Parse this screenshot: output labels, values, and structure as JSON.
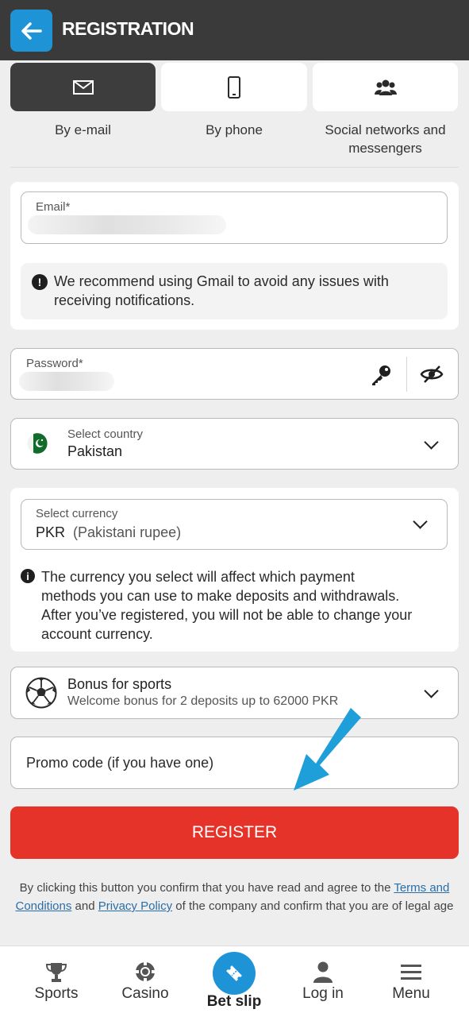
{
  "header": {
    "title": "REGISTRATION",
    "back_icon": "arrow-left-icon"
  },
  "methods": [
    {
      "label": "By e-mail",
      "icon": "envelope-icon",
      "active": true
    },
    {
      "label": "By phone",
      "icon": "phone-icon",
      "active": false
    },
    {
      "label_line1": "Social networks and",
      "label_line2": "messengers",
      "icon": "people-icon",
      "active": false
    }
  ],
  "email": {
    "label": "Email*",
    "value": ""
  },
  "email_notice": {
    "line1": "We recommend using Gmail to avoid any issues with",
    "line2": "receiving notifications."
  },
  "password": {
    "label": "Password*",
    "value": ""
  },
  "country": {
    "label": "Select country",
    "value": "Pakistan"
  },
  "currency": {
    "label": "Select currency",
    "code": "PKR",
    "name": "(Pakistani rupee)"
  },
  "currency_notice": {
    "line1": "The currency you select will affect which payment",
    "line2": "methods you can use to make deposits and withdrawals.",
    "line3": "After you’ve registered, you will not be able to change your",
    "line4": "account currency."
  },
  "bonus": {
    "title": "Bonus for sports",
    "subtitle": "Welcome bonus for 2 deposits up to 62000 PKR"
  },
  "promo": {
    "placeholder": "Promo code (if you have one)"
  },
  "register_label": "REGISTER",
  "legal": {
    "part1": "By clicking this button you confirm that you have read and agree to the ",
    "terms": "Terms and Conditions",
    "part2": " and ",
    "privacy": "Privacy Policy",
    "part3": " of the company and confirm that you are of legal age"
  },
  "nav": [
    {
      "label": "Sports",
      "icon": "trophy-icon"
    },
    {
      "label": "Casino",
      "icon": "casino-chip-icon"
    },
    {
      "label": "Bet slip",
      "icon": "ticket-icon"
    },
    {
      "label": "Log in",
      "icon": "user-icon"
    },
    {
      "label": "Menu",
      "icon": "hamburger-icon"
    }
  ],
  "colors": {
    "accent": "#1e93d6",
    "register": "#e5332a",
    "header": "#3a3a3a"
  }
}
